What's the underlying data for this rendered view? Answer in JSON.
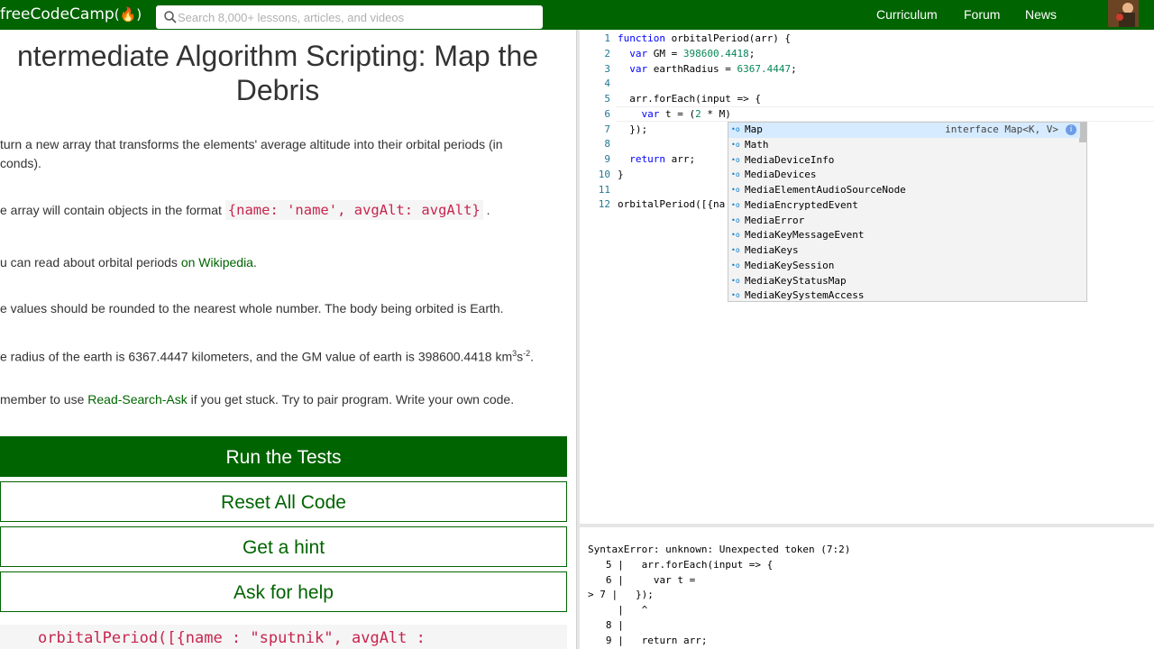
{
  "navbar": {
    "logo_text": "freeCodeCamp",
    "logo_flame": "(🔥)",
    "search_placeholder": "Search 8,000+ lessons, articles, and videos",
    "links": [
      "Curriculum",
      "Forum",
      "News"
    ]
  },
  "challenge": {
    "title": "ntermediate Algorithm Scripting: Map the Debris",
    "p1": "turn a new array that transforms the elements' average altitude into their orbital periods (in",
    "p1b": "conds).",
    "p2_pre": "e array will contain objects in the format ",
    "p2_code": "{name: 'name', avgAlt: avgAlt}",
    "p2_post": ".",
    "p3_pre": "u can read about orbital periods ",
    "p3_link": "on Wikipedia",
    "p3_post": ".",
    "p4": "e values should be rounded to the nearest whole number. The body being orbited is Earth.",
    "p5_pre": "e radius of the earth is 6367.4447 kilometers, and the GM value of earth is 398600.4418 km",
    "p5_sup1": "3",
    "p5_s": "s",
    "p5_sup2": "-2",
    "p5_post": ".",
    "p6_pre": "member to use ",
    "p6_link": "Read-Search-Ask",
    "p6_post": " if you get stuck. Try to pair program. Write your own code."
  },
  "buttons": {
    "run": "Run the Tests",
    "reset": "Reset All Code",
    "hint": "Get a hint",
    "help": "Ask for help"
  },
  "test_code": "orbitalPeriod([{name : \"sputnik\", avgAlt :",
  "editor": {
    "lines": [
      {
        "n": "1",
        "text": "function orbitalPeriod(arr) {"
      },
      {
        "n": "2",
        "text": "  var GM = 398600.4418;"
      },
      {
        "n": "3",
        "text": "  var earthRadius = 6367.4447;"
      },
      {
        "n": "4",
        "text": ""
      },
      {
        "n": "5",
        "text": "  arr.forEach(input => {"
      },
      {
        "n": "6",
        "text": "    var t = (2 * M)"
      },
      {
        "n": "7",
        "text": "  });"
      },
      {
        "n": "8",
        "text": ""
      },
      {
        "n": "9",
        "text": "  return arr;"
      },
      {
        "n": "10",
        "text": "}"
      },
      {
        "n": "11",
        "text": ""
      },
      {
        "n": "12",
        "text": "orbitalPeriod([{na"
      }
    ]
  },
  "suggest": {
    "items": [
      "Map",
      "Math",
      "MediaDeviceInfo",
      "MediaDevices",
      "MediaElementAudioSourceNode",
      "MediaEncryptedEvent",
      "MediaError",
      "MediaKeyMessageEvent",
      "MediaKeys",
      "MediaKeySession",
      "MediaKeyStatusMap",
      "MediaKeySystemAccess"
    ],
    "detail": "interface Map<K, V>",
    "icon": "•o"
  },
  "console": {
    "lines": [
      "SyntaxError: unknown: Unexpected token (7:2)",
      "   5 |   arr.forEach(input => {",
      "   6 |     var t =",
      "> 7 |   });",
      "     |   ^",
      "   8 |",
      "   9 |   return arr;"
    ]
  }
}
